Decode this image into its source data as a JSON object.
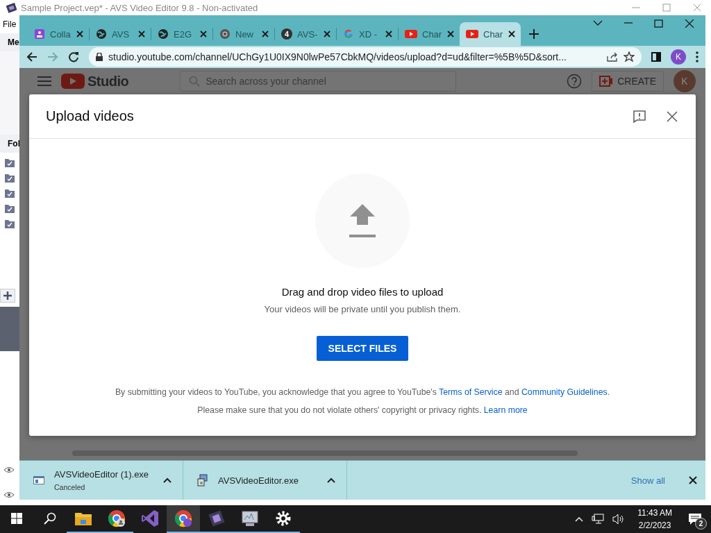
{
  "avs_window": {
    "title": "Sample Project.vep* - AVS Video Editor 9.8 - Non-activated",
    "menu": [
      "File"
    ],
    "labels": [
      "Me",
      "Fol"
    ]
  },
  "browser": {
    "tabs": [
      {
        "label": "Colla",
        "kind": "contacts",
        "selected": false
      },
      {
        "label": "AVS",
        "kind": "globe",
        "selected": false
      },
      {
        "label": "E2G",
        "kind": "globe",
        "selected": false
      },
      {
        "label": "New",
        "kind": "chrome",
        "selected": false
      },
      {
        "label": "AVS-",
        "kind": "badge",
        "badge": "4",
        "selected": false
      },
      {
        "label": "XD -",
        "kind": "google",
        "selected": false
      },
      {
        "label": "Char",
        "kind": "youtube",
        "selected": false
      },
      {
        "label": "Char",
        "kind": "youtube",
        "selected": true
      }
    ],
    "address": "studio.youtube.com/channel/UChGy1U0IX9N0lwPe57CbkMQ/videos/upload?d=ud&filter=%5B%5D&sort...",
    "profile": "K"
  },
  "studio_header": {
    "logo": "Studio",
    "search_placeholder": "Search across your channel",
    "create": "CREATE",
    "avatar": "K"
  },
  "dialog": {
    "title": "Upload videos",
    "prompt": "Drag and drop video files to upload",
    "note": "Your videos will be private until you publish them.",
    "button": "SELECT FILES",
    "legal": [
      {
        "text": "By submitting your videos to YouTube, you acknowledge that you agree to YouTube's ",
        "link": false
      },
      {
        "text": "Terms of Service",
        "link": true
      },
      {
        "text": " and ",
        "link": false
      },
      {
        "text": "Community Guidelines",
        "link": true
      },
      {
        "text": ".",
        "link": false
      }
    ],
    "legal_2": [
      {
        "text": "Please make sure that you do not violate others' copyright or privacy rights. ",
        "link": false
      },
      {
        "text": "Learn more",
        "link": true
      }
    ]
  },
  "downloads": {
    "items": [
      {
        "name": "AVSVideoEditor (1).exe",
        "status": "Canceled",
        "kind": "window"
      },
      {
        "name": "AVSVideoEditor.exe",
        "kind": "installer"
      }
    ],
    "show_all": "Show all"
  },
  "taskbar": {
    "apps": [
      {
        "kind": "explorer",
        "running": true,
        "active": false
      },
      {
        "kind": "chrome-profile",
        "running": true,
        "active": false
      },
      {
        "kind": "visual-studio",
        "running": false,
        "active": false
      },
      {
        "kind": "chrome",
        "running": true,
        "active": true
      },
      {
        "kind": "film",
        "running": true,
        "active": false
      },
      {
        "kind": "monitor",
        "running": true,
        "active": false
      },
      {
        "kind": "settings",
        "running": true,
        "active": false
      }
    ],
    "time": "11:43 AM",
    "date": "2/2/2023",
    "notifications": "2"
  }
}
